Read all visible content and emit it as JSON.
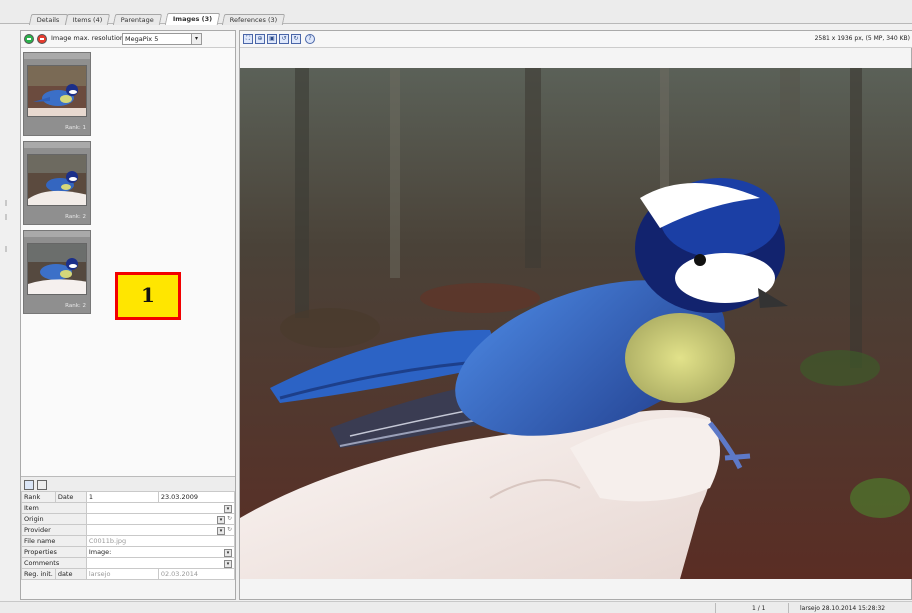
{
  "tabs": [
    {
      "label": "Details",
      "active": false
    },
    {
      "label": "Items (4)",
      "active": false
    },
    {
      "label": "Parentage",
      "active": false
    },
    {
      "label": "Images (3)",
      "active": true
    },
    {
      "label": "References (3)",
      "active": false
    }
  ],
  "left_toolbar": {
    "add_icon": "plus-icon",
    "remove_icon": "minus-icon",
    "resolution_label": "Image max. resolution:",
    "resolution_value": "MegaPix 5"
  },
  "thumbnails": [
    {
      "rank": "Rank: 1"
    },
    {
      "rank": "Rank: 2"
    },
    {
      "rank": "Rank: 2"
    }
  ],
  "badge": "1",
  "properties": {
    "rank_label": "Rank",
    "date_label": "Date",
    "rank_value": "1",
    "date_value": "23.03.2009",
    "item_label": "Item",
    "origin_label": "Origin",
    "provider_label": "Provider",
    "file_name_label": "File name",
    "file_name_value": "C0011b.jpg",
    "properties_label": "Properties",
    "properties_value": "Image:",
    "comments_label": "Comments",
    "reg_init_label": "Reg. init.",
    "reg_date_label": "date",
    "reg_init_value": "larsejo",
    "reg_date_value": "02.03.2014"
  },
  "main_toolbar": {
    "image_info": "2581 x 1936 px, (5 MP, 340 KB)",
    "icons": [
      "fit-icon",
      "zoom-icon",
      "save-icon",
      "rotate-left-icon",
      "rotate-right-icon",
      "help-icon"
    ]
  },
  "statusbar": {
    "page": "1 / 1",
    "user_time": "larsejo 28.10.2014 15:28:32"
  }
}
